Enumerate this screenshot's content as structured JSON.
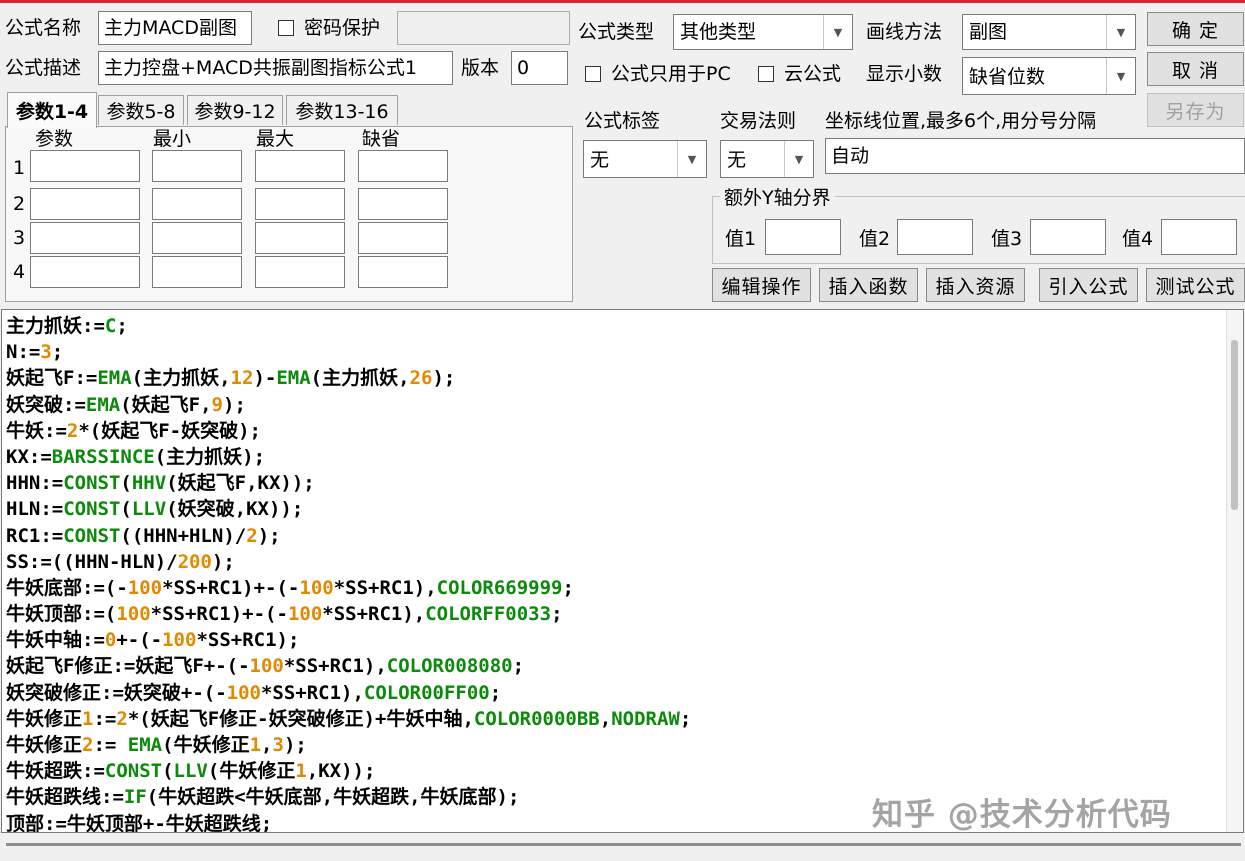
{
  "top_form": {
    "name_label": "公式名称",
    "name_value": "主力MACD副图",
    "password_label": "密码保护",
    "password_value": "",
    "desc_label": "公式描述",
    "desc_value": "主力控盘+MACD共振副图指标公式1",
    "version_label": "版本",
    "version_value": "0",
    "type_label": "公式类型",
    "type_value": "其他类型",
    "draw_label": "画线方法",
    "draw_value": "副图",
    "pc_only_label": "公式只用于PC",
    "cloud_label": "云公式",
    "decimals_label": "显示小数",
    "decimals_value": "缺省位数",
    "tag_label": "公式标签",
    "tag_value": "无",
    "trade_label": "交易法则",
    "trade_value": "无",
    "coord_label": "坐标线位置,最多6个,用分号分隔",
    "coord_value": "自动",
    "extra_y_title": "额外Y轴分界",
    "extra_y_labels": [
      "值1",
      "值2",
      "值3",
      "值4"
    ]
  },
  "buttons": {
    "ok": "确  定",
    "cancel": "取  消",
    "save_as": "另存为",
    "edit_ops": "编辑操作",
    "insert_func": "插入函数",
    "insert_res": "插入资源",
    "import_formula": "引入公式",
    "test_formula": "测试公式"
  },
  "param_tabs": [
    "参数1-4",
    "参数5-8",
    "参数9-12",
    "参数13-16"
  ],
  "param_headers": [
    "参数",
    "最小",
    "最大",
    "缺省"
  ],
  "param_rows": [
    "1",
    "2",
    "3",
    "4"
  ],
  "code_lines": [
    "主力抓妖:=C;",
    "N:=3;",
    "妖起飞F:=EMA(主力抓妖,12)-EMA(主力抓妖,26);",
    "妖突破:=EMA(妖起飞F,9);",
    "牛妖:=2*(妖起飞F-妖突破);",
    "KX:=BARSSINCE(主力抓妖);",
    "HHN:=CONST(HHV(妖起飞F,KX));",
    "HLN:=CONST(LLV(妖突破,KX));",
    "RC1:=CONST((HHN+HLN)/2);",
    "SS:=((HHN-HLN)/200);",
    "牛妖底部:=(-100*SS+RC1)+-(-100*SS+RC1),COLOR669999;",
    "牛妖顶部:=(100*SS+RC1)+-(-100*SS+RC1),COLORFF0033;",
    "牛妖中轴:=0+-(-100*SS+RC1);",
    "妖起飞F修正:=妖起飞F+-(-100*SS+RC1),COLOR008080;",
    "妖突破修正:=妖突破+-(-100*SS+RC1),COLOR00FF00;",
    "牛妖修正1:=2*(妖起飞F修正-妖突破修正)+牛妖中轴,COLOR0000BB,NODRAW;",
    "牛妖修正2:= EMA(牛妖修正1,3);",
    "牛妖超跌:=CONST(LLV(牛妖修正1,KX));",
    "牛妖超跌线:=IF(牛妖超跌<牛妖底部,牛妖超跌,牛妖底部);",
    "顶部:=牛妖顶部+-牛妖超跌线;"
  ],
  "syntax_colors": {
    "function": "#0b8a0b",
    "number": "#e08a00",
    "text": "#000000"
  },
  "watermark": "知乎 @技术分析代码"
}
